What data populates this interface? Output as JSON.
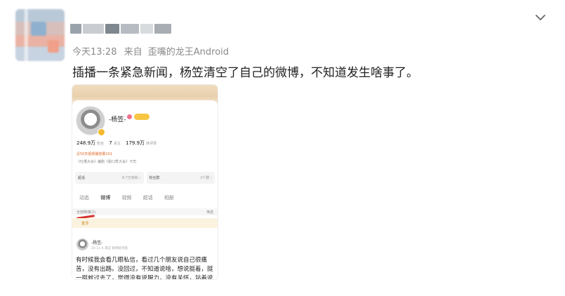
{
  "meta": {
    "time": "今天13:28",
    "source_prefix": "来自",
    "source": "歪嘴的龙王Android"
  },
  "post": {
    "text": "插播一条紧急新闻，杨笠清空了自己的微博，不知道发生啥事了。"
  },
  "icons": {
    "expand": "chevron-down-icon"
  },
  "screenshot": {
    "profile_name": "-杨笠-",
    "stats": [
      {
        "value": "248.9万",
        "label": "粉丝"
      },
      {
        "value": "7",
        "label": "关注"
      },
      {
        "value": "179.9万",
        "label": "转评赞"
      }
    ],
    "desc_line1": "近50天视频播放量101",
    "desc_line2": "《吐槽大会》编剧《脱口秀大会》卡司",
    "card_left": {
      "label": "超话",
      "extra": "8.7万铁粉 ›"
    },
    "card_right": {
      "label": "粉丝群",
      "extra": "2个群 ›"
    },
    "tabs": [
      "动态",
      "微博",
      "视频",
      "超话",
      "相册"
    ],
    "filter_left": "全部微博(2)",
    "filter_right": "筛选",
    "pinned": "置顶",
    "post_name": "-杨笠-",
    "post_time": "20-11-4 来自 微博轻享版",
    "post_body": "有时候我会看几眼私信，看过几个朋友说自己很痛苦，没有出路。没回过，不知道说啥，想说挺着，挺一挺就过去了，觉得没有说服力，没有关怀，站着说话不腰疼，不如不回。"
  },
  "colors": {
    "accent_red": "#d6322d",
    "meta_gray": "#8a8a8a"
  }
}
